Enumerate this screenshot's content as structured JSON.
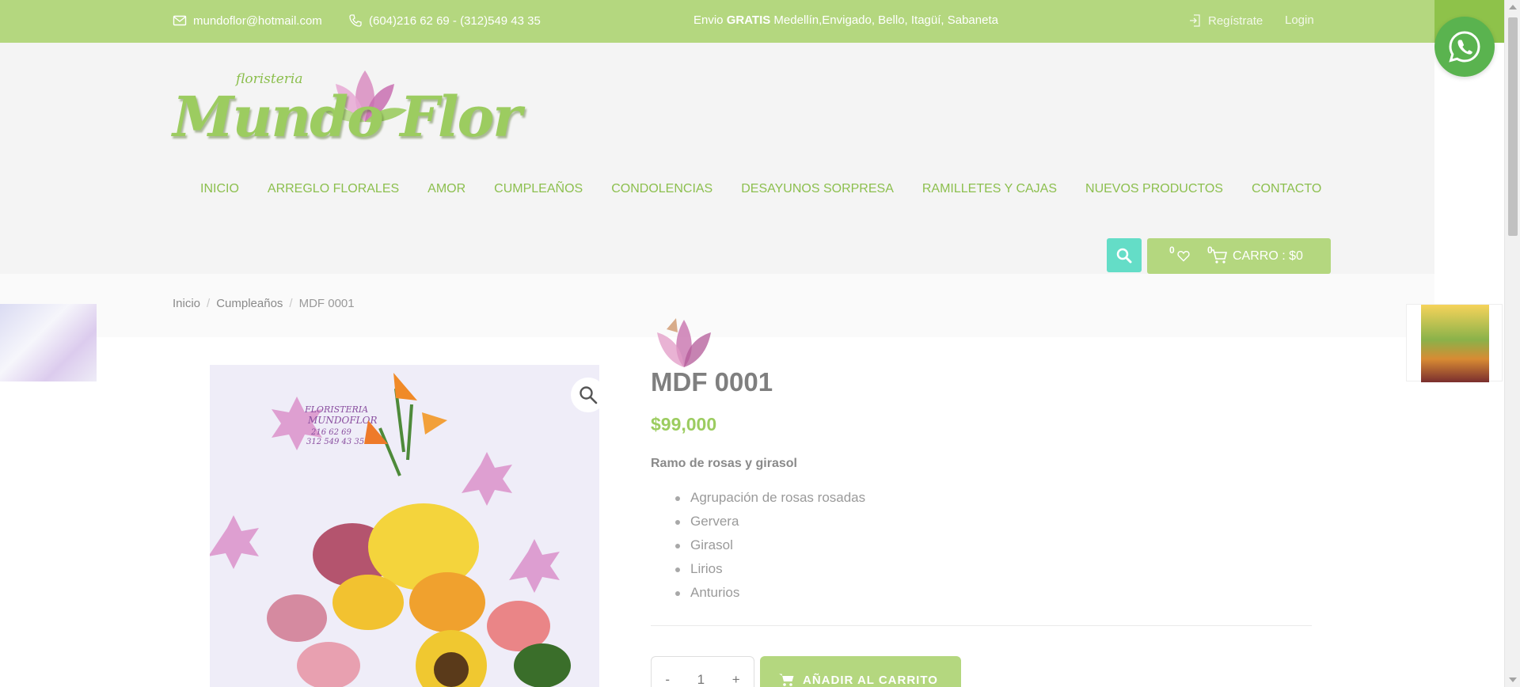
{
  "topbar": {
    "email": "mundoflor@hotmail.com",
    "phones": "(604)216 62 69 - (312)549 43 35",
    "shipping_prefix": "Envio ",
    "shipping_bold": "GRATIS",
    "shipping_rest": " Medellín,Envigado, Bello, Itagüí, Sabaneta",
    "register": "Regístrate",
    "login": "Login"
  },
  "logo": {
    "small_text": "floristeria",
    "main_text": "Mundo Flor"
  },
  "nav": {
    "items": [
      "INICIO",
      "ARREGLO FLORALES",
      "AMOR",
      "CUMPLEAÑOS",
      "CONDOLENCIAS",
      "DESAYUNOS SORPRESA",
      "RAMILLETES Y CAJAS",
      "NUEVOS PRODUCTOS",
      "CONTACTO"
    ]
  },
  "cart": {
    "wishlist_count": "0",
    "cart_count": "0",
    "label": "CARRO : $0"
  },
  "breadcrumb": {
    "home": "Inicio",
    "category": "Cumpleaños",
    "current": "MDF 0001",
    "separator": "/"
  },
  "product": {
    "title": "MDF 0001",
    "price": "$99,000",
    "short_description": "Ramo de rosas y girasol",
    "features": [
      "Agrupación de rosas rosadas",
      "Gervera",
      "Girasol",
      "Lirios",
      "Anturios"
    ],
    "image_watermark": {
      "brand_top": "FLORISTERIA",
      "brand_name": "MUNDOFLOR",
      "phone1": "216 62 69",
      "phone2": "312 549 43 35"
    }
  },
  "purchase": {
    "minus": "-",
    "quantity": "1",
    "plus": "+",
    "add_to_cart": "AÑADIR AL CARRITO"
  },
  "colors": {
    "brand_green": "#b4d77f",
    "nav_green": "#8cbf4e",
    "search_teal": "#64ddc7",
    "whatsapp": "#5ab34f"
  },
  "icons": {
    "email": "envelope-icon",
    "phone": "phone-icon",
    "register": "login-arrow-icon",
    "whatsapp": "whatsapp-icon",
    "search": "search-icon",
    "wishlist": "heart-icon",
    "cart": "cart-icon",
    "zoom": "magnifier-icon"
  }
}
